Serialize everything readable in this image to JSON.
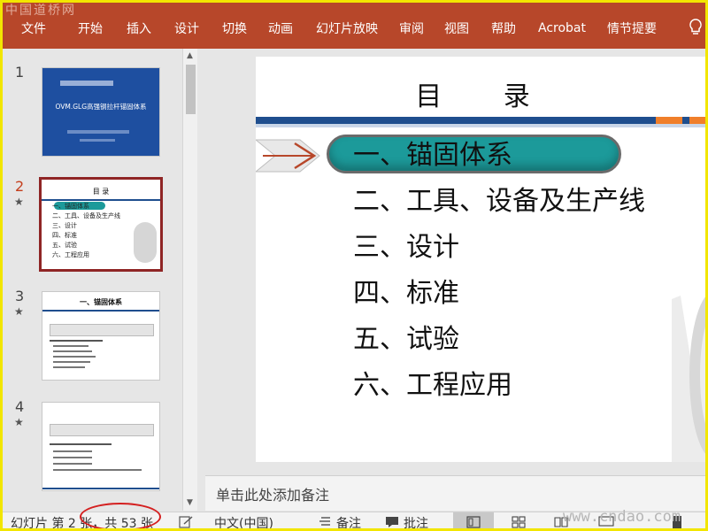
{
  "watermarks": {
    "top": "中国道桥网",
    "bottom": "www.cndao.com"
  },
  "ribbon": {
    "tabs": [
      "文件",
      "开始",
      "插入",
      "设计",
      "切换",
      "动画",
      "幻灯片放映",
      "审阅",
      "视图",
      "帮助",
      "Acrobat",
      "情节提要"
    ],
    "accent_color": "#b7472a"
  },
  "thumbnails": [
    {
      "number": "1",
      "star": "",
      "title": "OVM.GLG高强钢拉杆锚固体系",
      "lines": []
    },
    {
      "number": "2",
      "star": "★",
      "title": "目 录",
      "lines": [
        "一、锚固体系",
        "二、工具、设备及生产线",
        "三、设计",
        "四、标准",
        "五、试验",
        "六、工程应用"
      ]
    },
    {
      "number": "3",
      "star": "★",
      "title": "一、锚固体系",
      "lines": []
    },
    {
      "number": "4",
      "star": "★",
      "title": "",
      "lines": []
    }
  ],
  "slide": {
    "title": "目 录",
    "items": [
      "一、锚固体系",
      "二、工具、设备及生产线",
      "三、设计",
      "四、标准",
      "五、试验",
      "六、工程应用"
    ],
    "pill_color": "#1c9a9a"
  },
  "notes": {
    "placeholder": "单击此处添加备注"
  },
  "status_bar": {
    "slide_position": "幻灯片 第 2 张，共 53 张",
    "language": "中文(中国)",
    "notes_label": "备注",
    "comments_label": "批注"
  }
}
